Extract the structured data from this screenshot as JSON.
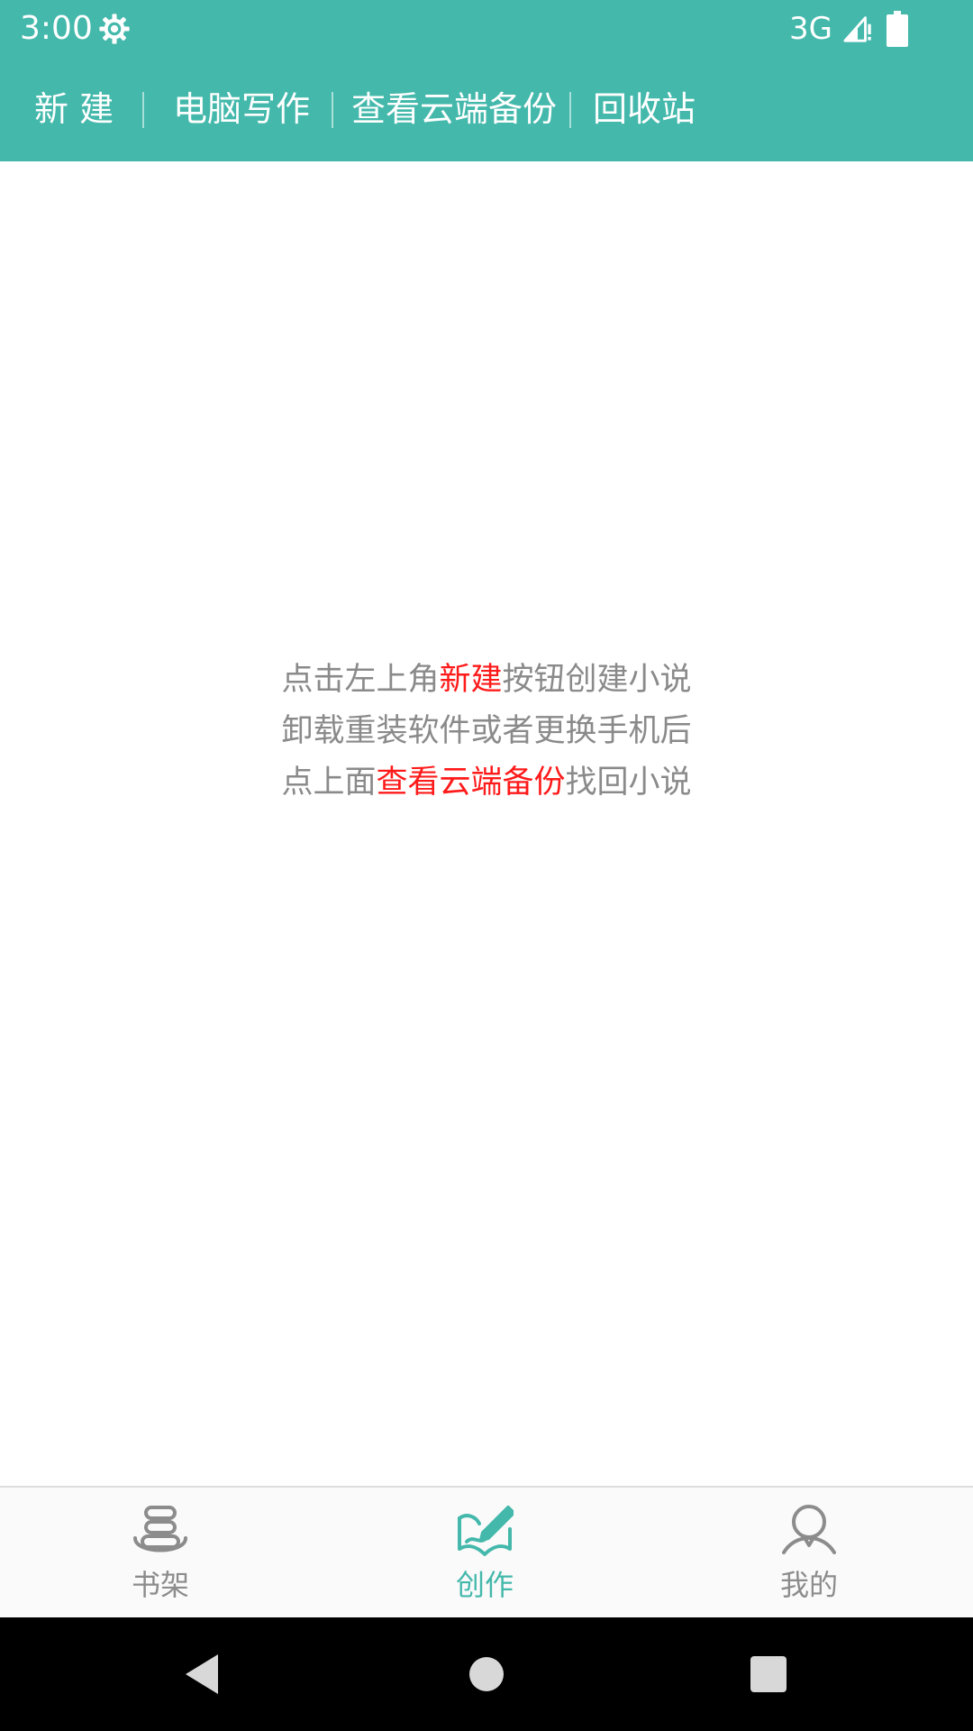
{
  "status_bar": {
    "time": "3:00",
    "network": "3G",
    "icons": [
      "gear-icon",
      "signal-icon",
      "battery-icon"
    ]
  },
  "toolbar": {
    "items": [
      {
        "label": "新 建"
      },
      {
        "label": "电脑写作"
      },
      {
        "label": "查看云端备份"
      },
      {
        "label": "回收站"
      }
    ]
  },
  "empty_hint": {
    "line1": {
      "before": "点击左上角",
      "highlight": "新建",
      "after": "按钮创建小说"
    },
    "line2": "卸载重装软件或者更换手机后",
    "line3": {
      "before": "点上面",
      "highlight": "查看云端备份",
      "after": "找回小说"
    }
  },
  "bottom_nav": {
    "items": [
      {
        "label": "书架",
        "icon": "bookshelf-icon",
        "active": false
      },
      {
        "label": "创作",
        "icon": "write-icon",
        "active": true
      },
      {
        "label": "我的",
        "icon": "profile-icon",
        "active": false
      }
    ]
  },
  "system_nav": {
    "icons": [
      "back-icon",
      "home-icon",
      "recents-icon"
    ]
  },
  "colors": {
    "primary": "#43b8ab",
    "highlight": "#ff1a1a",
    "hint_text": "#8a8a8a",
    "nav_inactive": "#8c8c8c"
  }
}
